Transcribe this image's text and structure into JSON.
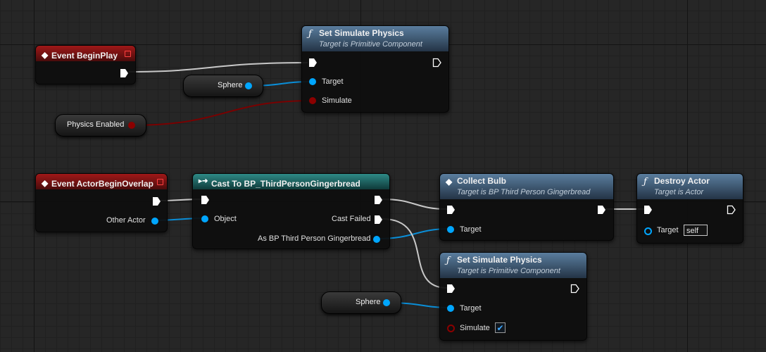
{
  "nodes": {
    "event_begin_play": {
      "title": "Event BeginPlay"
    },
    "set_sim_1": {
      "title": "Set Simulate Physics",
      "subtitle": "Target is Primitive Component",
      "target": "Target",
      "simulate": "Simulate"
    },
    "sphere_1": {
      "label": "Sphere"
    },
    "physics_enabled": {
      "label": "Physics Enabled"
    },
    "event_overlap": {
      "title": "Event ActorBeginOverlap",
      "other_actor": "Other Actor"
    },
    "cast": {
      "title": "Cast To BP_ThirdPersonGingerbread",
      "object": "Object",
      "cast_failed": "Cast Failed",
      "as_output": "As BP Third Person Gingerbread"
    },
    "collect_bulb": {
      "title": "Collect Bulb",
      "subtitle": "Target is BP Third Person Gingerbread",
      "target": "Target"
    },
    "destroy_actor": {
      "title": "Destroy Actor",
      "subtitle": "Target is Actor",
      "target": "Target",
      "target_value": "self"
    },
    "set_sim_2": {
      "title": "Set Simulate Physics",
      "subtitle": "Target is Primitive Component",
      "target": "Target",
      "simulate": "Simulate",
      "simulate_checked": "✔"
    },
    "sphere_2": {
      "label": "Sphere"
    }
  },
  "colors": {
    "exec_wire": "#d0d0d0",
    "object_wire": "#0a8ed8",
    "bool_wire": "#8b0000"
  }
}
